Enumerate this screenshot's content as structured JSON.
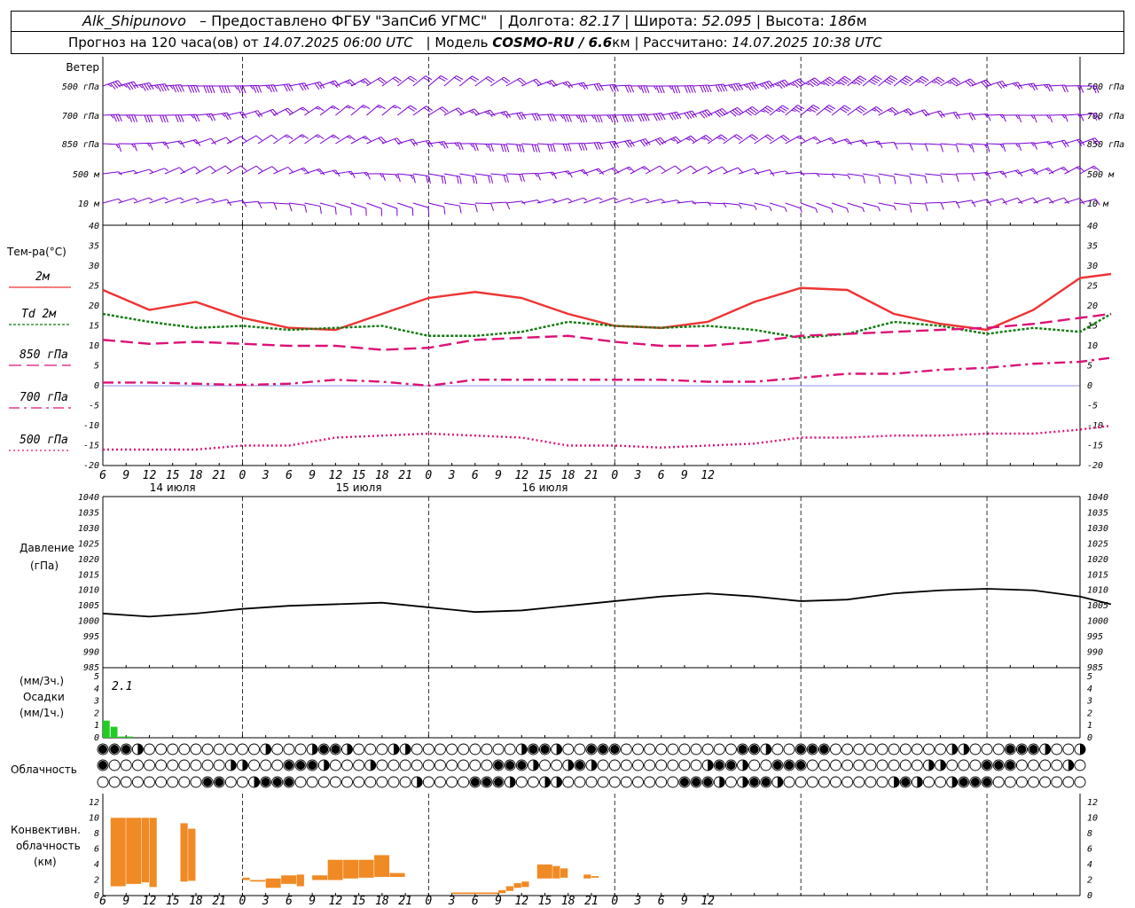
{
  "header": {
    "station": "Alk_Shipunovo",
    "provider": "– Предоставлено ФГБУ \"ЗапСиб УГМС\"",
    "lon_label": "Долгота:",
    "lon": "82.17",
    "lat_label": "Широта:",
    "lat": "52.095",
    "alt_label": "Высота:",
    "alt": "186",
    "alt_unit": "м",
    "fc_label": "Прогноз на 120 часа(ов) от",
    "fc_time": "14.07.2025 06:00 UTC",
    "model_label": "Модель",
    "model": "COSMO-RU / 6.6",
    "model_unit": "км",
    "calc_label": "Рассчитано:",
    "calc_time": "14.07.2025 10:38 UTC"
  },
  "wind": {
    "title": "Ветер",
    "levels": [
      "500 гПа",
      "700 гПа",
      "850 гПа",
      "500 м",
      "10 м"
    ],
    "color": "#7b00d4"
  },
  "temperature": {
    "title": "Тем-ра(°C)",
    "legend": [
      {
        "label": "2м",
        "color": "#ee3333",
        "style": "solid"
      },
      {
        "label": "Td  2м",
        "color": "#0b7a0b",
        "style": "dotted"
      },
      {
        "label": "850 гПа",
        "color": "#dd1177",
        "style": "dash"
      },
      {
        "label": "700 гПа",
        "color": "#dd1177",
        "style": "dashdot"
      },
      {
        "label": "500 гПа",
        "color": "#dd1177",
        "style": "dot"
      }
    ]
  },
  "pressure": {
    "title": "Давление",
    "unit": "(гПа)"
  },
  "precip": {
    "unit1": "(мм/3ч.)",
    "title": "Осадки",
    "unit2": "(мм/1ч.)",
    "max_label": "2.1",
    "color": "#22cc22"
  },
  "cloud": {
    "title": "Облачность"
  },
  "conv": {
    "title1": "Конвективн.",
    "title2": "облачность",
    "unit": "(км)",
    "color": "#f08a24"
  },
  "time_axis": {
    "hour_labels": [
      "6",
      "9",
      "12",
      "15",
      "18",
      "21",
      "0",
      "3",
      "6",
      "9",
      "12",
      "15",
      "18",
      "21",
      "0",
      "3",
      "6",
      "9",
      "12",
      "15",
      "18",
      "21",
      "0",
      "3",
      "6",
      "9",
      "12"
    ],
    "day_labels": [
      "14 июля",
      "15 июля",
      "16 июля"
    ]
  },
  "chart_data": [
    {
      "type": "line",
      "title": "",
      "ylabel": "Тем-ра(°C)",
      "ylim": [
        -20,
        40
      ],
      "x_hours": [
        0,
        6,
        12,
        18,
        24,
        30,
        36,
        42,
        48,
        54,
        60,
        66,
        72,
        78,
        84,
        90,
        96,
        102,
        108,
        114,
        120,
        126,
        130
      ],
      "series": [
        {
          "name": "2м",
          "values": [
            24,
            19,
            21,
            17,
            14.5,
            14,
            18,
            22,
            23.5,
            22,
            18,
            15,
            14.5,
            16,
            21,
            24.5,
            24,
            18,
            15.5,
            14,
            19,
            27,
            28
          ]
        },
        {
          "name": "Td  2м",
          "values": [
            18,
            16,
            14.5,
            15,
            14,
            14.5,
            15,
            12.5,
            12.5,
            13.5,
            16,
            15,
            14.5,
            15,
            14,
            12,
            13,
            16,
            15,
            13,
            14.5,
            13.5,
            18
          ]
        },
        {
          "name": "850 гПа",
          "values": [
            11.5,
            10.5,
            11,
            10.5,
            10,
            10,
            9,
            9.5,
            11.5,
            12,
            12.5,
            11,
            10,
            10,
            11,
            12.5,
            13,
            13.5,
            14,
            14.5,
            15.5,
            17,
            18
          ]
        },
        {
          "name": "700 гПа",
          "values": [
            0.8,
            0.8,
            0.5,
            0.2,
            0.5,
            1.5,
            1,
            0,
            1.5,
            1.5,
            1.5,
            1.5,
            1.5,
            1,
            1,
            2,
            3,
            3,
            4,
            4.5,
            5.5,
            6,
            7
          ]
        },
        {
          "name": "500 гПа",
          "values": [
            -16,
            -16,
            -16,
            -15,
            -15,
            -13,
            -12.5,
            -12,
            -12.5,
            -13,
            -15,
            -15,
            -15.5,
            -15,
            -14.5,
            -13,
            -13,
            -12.5,
            -12.5,
            -12,
            -12,
            -11,
            -10
          ]
        }
      ]
    },
    {
      "type": "line",
      "title": "",
      "ylabel": "Давление (гПа)",
      "ylim": [
        985,
        1040
      ],
      "x_hours": [
        0,
        6,
        12,
        18,
        24,
        30,
        36,
        42,
        48,
        54,
        60,
        66,
        72,
        78,
        84,
        90,
        96,
        102,
        108,
        114,
        120,
        126,
        130
      ],
      "series": [
        {
          "name": "",
          "values": [
            1002.5,
            1001.5,
            1002.5,
            1004,
            1005,
            1005.5,
            1006,
            1004.5,
            1003,
            1003.5,
            1005,
            1006.5,
            1008,
            1009,
            1008,
            1006.5,
            1007,
            1009,
            1010,
            1010.5,
            1010,
            1008,
            1005.5
          ]
        }
      ]
    },
    {
      "type": "bar",
      "title": "",
      "ylabel": "Осадки (мм/1ч.)",
      "ylim": [
        0,
        5
      ],
      "x_hours": [
        0,
        1,
        2,
        3,
        4,
        5
      ],
      "values": [
        1.4,
        0.9,
        0.1,
        0.1,
        0,
        0
      ]
    },
    {
      "type": "bar",
      "title": "",
      "ylabel": "Конвективн. облачность (км)",
      "ylim": [
        0,
        13
      ],
      "bars": [
        {
          "x0": 1,
          "x1": 3,
          "base": 1.2,
          "top": 10
        },
        {
          "x0": 3,
          "x1": 5,
          "base": 1.5,
          "top": 10
        },
        {
          "x0": 5,
          "x1": 6,
          "base": 1.7,
          "top": 10
        },
        {
          "x0": 6,
          "x1": 7,
          "base": 1.1,
          "top": 10
        },
        {
          "x0": 10,
          "x1": 11,
          "base": 1.8,
          "top": 9.3
        },
        {
          "x0": 11,
          "x1": 12,
          "base": 1.9,
          "top": 8.6
        },
        {
          "x0": 18,
          "x1": 19,
          "base": 2.0,
          "top": 2.3
        },
        {
          "x0": 19,
          "x1": 21,
          "base": 1.8,
          "top": 2.0
        },
        {
          "x0": 21,
          "x1": 23,
          "base": 1.0,
          "top": 2.2
        },
        {
          "x0": 23,
          "x1": 25,
          "base": 1.5,
          "top": 2.6
        },
        {
          "x0": 25,
          "x1": 26,
          "base": 1.2,
          "top": 2.7
        },
        {
          "x0": 27,
          "x1": 29,
          "base": 2.0,
          "top": 2.6
        },
        {
          "x0": 29,
          "x1": 31,
          "base": 2.0,
          "top": 4.6
        },
        {
          "x0": 31,
          "x1": 33,
          "base": 2.2,
          "top": 4.6
        },
        {
          "x0": 33,
          "x1": 35,
          "base": 2.3,
          "top": 4.6
        },
        {
          "x0": 35,
          "x1": 37,
          "base": 2.4,
          "top": 5.2
        },
        {
          "x0": 37,
          "x1": 39,
          "base": 2.4,
          "top": 2.9
        },
        {
          "x0": 45,
          "x1": 51,
          "base": 0.2,
          "top": 0.4
        },
        {
          "x0": 51,
          "x1": 52,
          "base": 0.3,
          "top": 0.7
        },
        {
          "x0": 52,
          "x1": 53,
          "base": 0.6,
          "top": 1.2
        },
        {
          "x0": 53,
          "x1": 54,
          "base": 1.0,
          "top": 1.6
        },
        {
          "x0": 54,
          "x1": 55,
          "base": 1.1,
          "top": 1.8
        },
        {
          "x0": 56,
          "x1": 58,
          "base": 2.2,
          "top": 4.0
        },
        {
          "x0": 58,
          "x1": 59,
          "base": 2.2,
          "top": 3.8
        },
        {
          "x0": 59,
          "x1": 60,
          "base": 2.3,
          "top": 3.5
        },
        {
          "x0": 62,
          "x1": 63,
          "base": 2.2,
          "top": 2.7
        },
        {
          "x0": 63,
          "x1": 64,
          "base": 2.3,
          "top": 2.5
        }
      ]
    }
  ]
}
